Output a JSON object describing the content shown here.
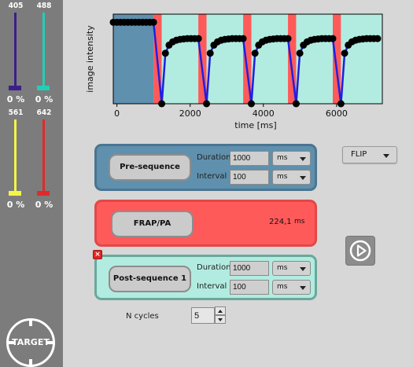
{
  "lasers": [
    {
      "wavelength": "405",
      "percent": "0 %",
      "color": "#3b1f8a",
      "level": 0
    },
    {
      "wavelength": "488",
      "percent": "0 %",
      "color": "#24cdb6",
      "level": 0
    },
    {
      "wavelength": "561",
      "percent": "0 %",
      "color": "#f4f44a",
      "level": 0
    },
    {
      "wavelength": "642",
      "percent": "0 %",
      "color": "#e02a2a",
      "level": 0
    }
  ],
  "target_button": {
    "label": "TARGET",
    "icon": "crosshair-icon"
  },
  "chart_data": {
    "type": "line",
    "xlabel": "time [ms]",
    "ylabel": "image intensity",
    "xticks": [
      "0",
      "2000",
      "4000",
      "6000"
    ],
    "xlim": [
      -100,
      7250
    ],
    "ylim": [
      0,
      1.1
    ],
    "grid": false,
    "colors": {
      "pre": "#5f90ad",
      "frap": "#ff5a5a",
      "post": "#b2ece0",
      "line": "#1f1fe0",
      "marker": "#000000"
    },
    "regions": [
      {
        "type": "pre",
        "start": -100,
        "end": 1000
      },
      {
        "type": "frap",
        "start": 1000,
        "end": 1224
      },
      {
        "type": "post",
        "start": 1224,
        "end": 2224
      },
      {
        "type": "frap",
        "start": 2224,
        "end": 2448
      },
      {
        "type": "post",
        "start": 2448,
        "end": 3448
      },
      {
        "type": "frap",
        "start": 3448,
        "end": 3672
      },
      {
        "type": "post",
        "start": 3672,
        "end": 4672
      },
      {
        "type": "frap",
        "start": 4672,
        "end": 4896
      },
      {
        "type": "post",
        "start": 4896,
        "end": 5896
      },
      {
        "type": "frap",
        "start": 5896,
        "end": 6120
      },
      {
        "type": "post",
        "start": 6120,
        "end": 7250
      }
    ],
    "series": [
      {
        "x": [
          -100,
          0,
          100,
          200,
          300,
          400,
          500,
          600,
          700,
          800,
          900,
          1000,
          1224,
          1324,
          1424,
          1524,
          1624,
          1724,
          1824,
          1924,
          2024,
          2124,
          2224,
          2448,
          2548,
          2648,
          2748,
          2848,
          2948,
          3048,
          3148,
          3248,
          3348,
          3448,
          3672,
          3772,
          3872,
          3972,
          4072,
          4172,
          4272,
          4372,
          4472,
          4572,
          4672,
          4896,
          4996,
          5096,
          5196,
          5296,
          5396,
          5496,
          5596,
          5696,
          5796,
          5896,
          6120,
          6220,
          6320,
          6420,
          6520,
          6620,
          6720,
          6820,
          6920,
          7020,
          7120
        ],
        "y": [
          1.0,
          1.0,
          1.0,
          1.0,
          1.0,
          1.0,
          1.0,
          1.0,
          1.0,
          1.0,
          1.0,
          1.0,
          0.0,
          0.62,
          0.72,
          0.76,
          0.78,
          0.79,
          0.795,
          0.8,
          0.8,
          0.8,
          0.8,
          0.0,
          0.62,
          0.72,
          0.76,
          0.78,
          0.79,
          0.795,
          0.8,
          0.8,
          0.8,
          0.8,
          0.0,
          0.62,
          0.72,
          0.76,
          0.78,
          0.79,
          0.795,
          0.8,
          0.8,
          0.8,
          0.8,
          0.0,
          0.62,
          0.72,
          0.76,
          0.78,
          0.79,
          0.795,
          0.8,
          0.8,
          0.8,
          0.8,
          0.0,
          0.62,
          0.72,
          0.76,
          0.78,
          0.79,
          0.795,
          0.8,
          0.8,
          0.8,
          0.8
        ]
      }
    ]
  },
  "pre_sequence": {
    "button_label": "Pre-sequence",
    "duration_label": "Duration",
    "duration_value": "1000",
    "duration_unit": "ms",
    "interval_label": "Interval",
    "interval_value": "100",
    "interval_unit": "ms"
  },
  "frap": {
    "button_label": "FRAP/PA",
    "value": "224,1",
    "unit": "ms"
  },
  "post_sequence": {
    "button_label": "Post-sequence 1",
    "remove_label": "×",
    "duration_label": "Duration",
    "duration_value": "1000",
    "duration_unit": "ms",
    "interval_label": "Interval",
    "interval_value": "100",
    "interval_unit": "ms"
  },
  "mode_dropdown": {
    "selected": "FLIP"
  },
  "play_button": {
    "icon": "play-icon"
  },
  "cycles": {
    "label": "N cycles",
    "value": "5"
  }
}
